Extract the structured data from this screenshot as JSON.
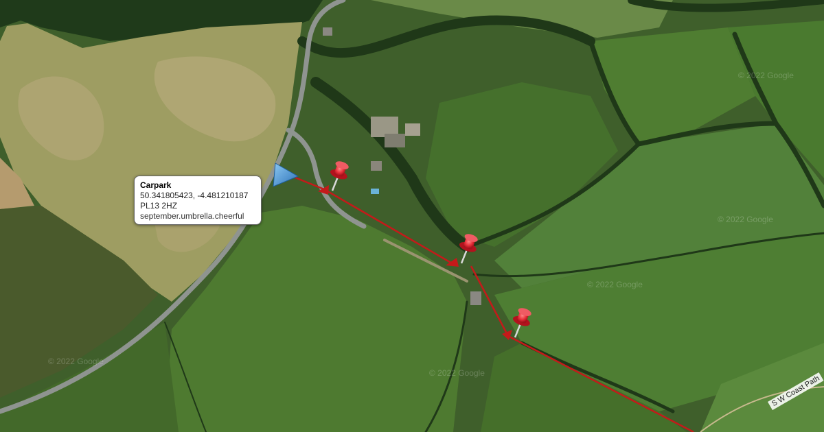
{
  "popup": {
    "title": "Carpark",
    "coordinates": "50.341805423, -4.481210187",
    "postcode": "PL13 2HZ",
    "what3words": "september.umbrella.cheerful"
  },
  "map": {
    "watermark": "© 2022 Google",
    "road_label": "S W Coast Path",
    "route_color": "#c41a1a",
    "pin_color": "#e8303a",
    "start_marker_color": "#3f8fd0",
    "markers": [
      "start-arrow-icon",
      "pin-icon",
      "pin-icon",
      "pin-icon"
    ]
  }
}
